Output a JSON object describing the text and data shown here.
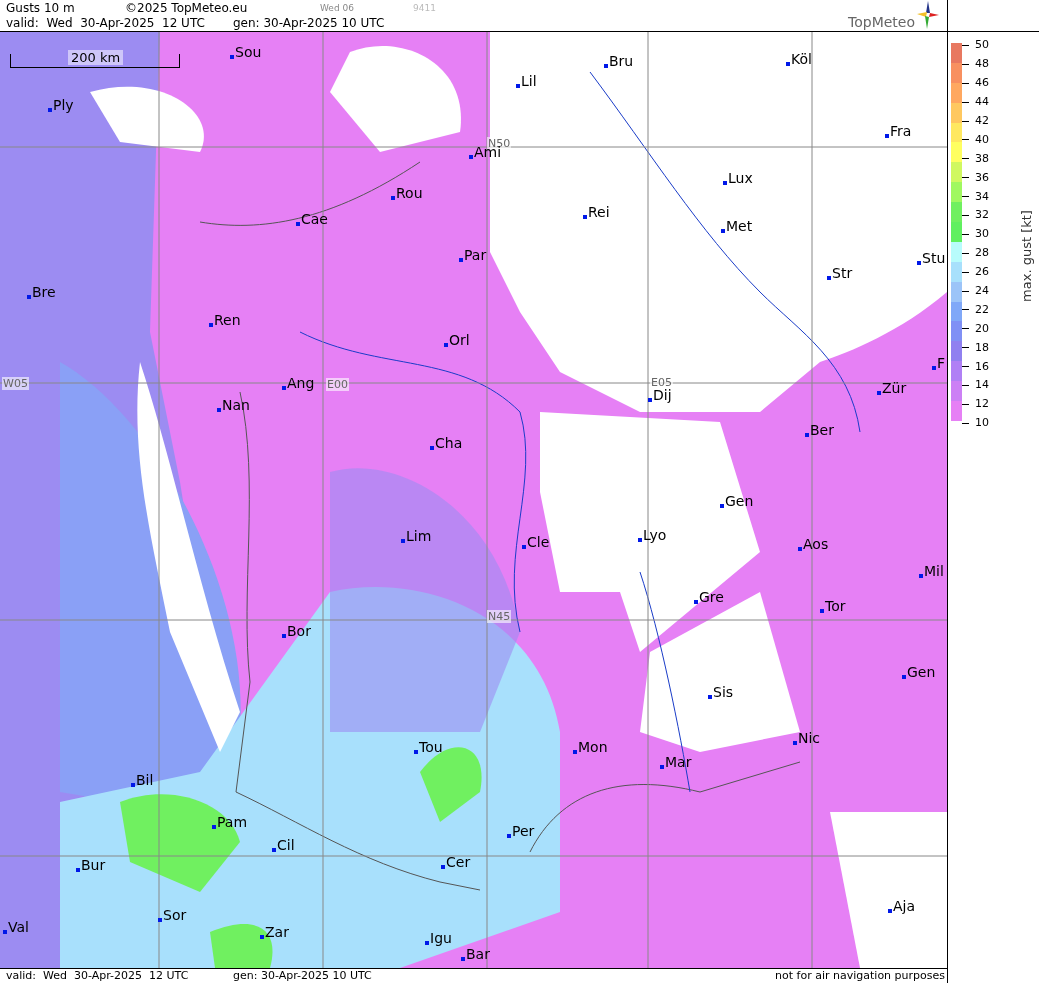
{
  "header": {
    "title": "Gusts 10 m",
    "copyright": "©2025 TopMeteo.eu",
    "day_code": "Wed 06",
    "run_code": "9411",
    "valid": "valid:  Wed  30-Apr-2025  12 UTC",
    "generated": "gen: 30-Apr-2025 10 UTC",
    "logo": "TopMeteo"
  },
  "map": {
    "scale_label": "200 km",
    "grid_labels": [
      "N50",
      "N45",
      "W05",
      "E00",
      "E05"
    ],
    "cities": [
      "Sou",
      "Bru",
      "Köl",
      "Ply",
      "Lil",
      "Ami",
      "Fra",
      "Lux",
      "Rou",
      "Cae",
      "Rei",
      "Met",
      "Par",
      "Stu",
      "Str",
      "Bre",
      "Ren",
      "Orl",
      "F",
      "Ang",
      "Nan",
      "Dij",
      "Zür",
      "Ber",
      "Cha",
      "Gen",
      "Lim",
      "Cle",
      "Lyo",
      "Aos",
      "Mil",
      "Gre",
      "Tor",
      "Bor",
      "Gen",
      "Sis",
      "Tou",
      "Nic",
      "Mon",
      "Mar",
      "Bil",
      "Pam",
      "Per",
      "Cil",
      "Cer",
      "Bur",
      "Sor",
      "Val",
      "Aja",
      "Zar",
      "Igu",
      "Bar"
    ]
  },
  "legend": {
    "title": "max. gust [kt]",
    "ticks": [
      "50",
      "48",
      "46",
      "44",
      "42",
      "40",
      "38",
      "36",
      "34",
      "32",
      "30",
      "28",
      "26",
      "24",
      "22",
      "20",
      "18",
      "16",
      "14",
      "12",
      "10"
    ],
    "bands": [
      {
        "color": "#e87860"
      },
      {
        "color": "#f89060"
      },
      {
        "color": "#ffa860"
      },
      {
        "color": "#ffc860"
      },
      {
        "color": "#ffe860"
      },
      {
        "color": "#ffff60"
      },
      {
        "color": "#d0f860"
      },
      {
        "color": "#a0f860"
      },
      {
        "color": "#70f060"
      },
      {
        "color": "#60f060"
      },
      {
        "color": "#b8fcfc"
      },
      {
        "color": "#a8e0fc"
      },
      {
        "color": "#9cc4f8"
      },
      {
        "color": "#80a8f8"
      },
      {
        "color": "#8090f5"
      },
      {
        "color": "#9080f0"
      },
      {
        "color": "#b080f5"
      },
      {
        "color": "#cc80f5"
      },
      {
        "color": "#e680f5"
      }
    ]
  },
  "footer": {
    "valid": "valid:  Wed  30-Apr-2025  12 UTC",
    "generated": "gen: 30-Apr-2025 10 UTC",
    "disclaimer": "not for air navigation purposes"
  }
}
